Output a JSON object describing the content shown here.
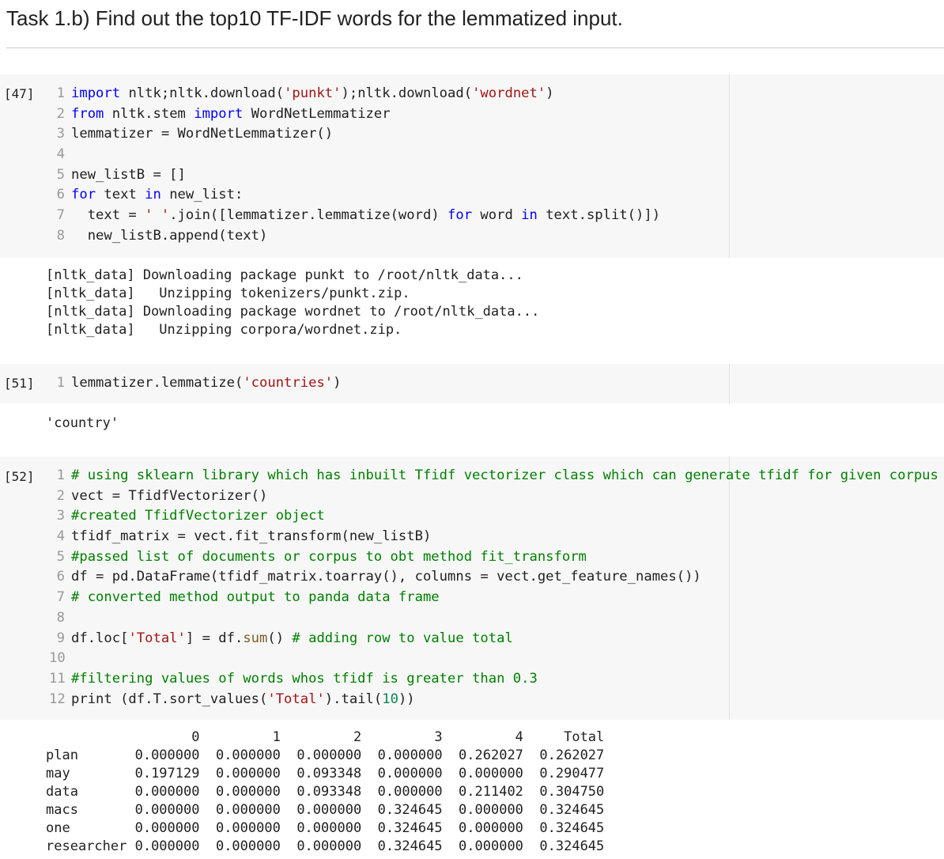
{
  "heading": "Task 1.b) Find out the top10 TF-IDF words for the lemmatized input.",
  "cells": {
    "c47": {
      "prompt": "[47]",
      "lines": [
        {
          "n": "1",
          "tokens": [
            {
              "t": "import",
              "c": "kw"
            },
            {
              "t": " nltk;nltk.download("
            },
            {
              "t": "'punkt'",
              "c": "str"
            },
            {
              "t": ");nltk.download("
            },
            {
              "t": "'wordnet'",
              "c": "str"
            },
            {
              "t": ")"
            }
          ]
        },
        {
          "n": "2",
          "tokens": [
            {
              "t": "from",
              "c": "kw"
            },
            {
              "t": " nltk.stem "
            },
            {
              "t": "import",
              "c": "kw"
            },
            {
              "t": " WordNetLemmatizer"
            }
          ]
        },
        {
          "n": "3",
          "tokens": [
            {
              "t": "lemmatizer = WordNetLemmatizer()"
            }
          ]
        },
        {
          "n": "4",
          "tokens": []
        },
        {
          "n": "5",
          "tokens": [
            {
              "t": "new_listB = []"
            }
          ]
        },
        {
          "n": "6",
          "tokens": [
            {
              "t": "for",
              "c": "kw"
            },
            {
              "t": " text "
            },
            {
              "t": "in",
              "c": "kw"
            },
            {
              "t": " new_list:"
            }
          ]
        },
        {
          "n": "7",
          "tokens": [
            {
              "t": "  text = "
            },
            {
              "t": "' '",
              "c": "str"
            },
            {
              "t": ".join([lemmatizer.lemmatize(word) "
            },
            {
              "t": "for",
              "c": "kw"
            },
            {
              "t": " word "
            },
            {
              "t": "in",
              "c": "kw"
            },
            {
              "t": " text.split()])"
            }
          ]
        },
        {
          "n": "8",
          "tokens": [
            {
              "t": "  new_listB.append(text)"
            }
          ]
        }
      ],
      "output": [
        "[nltk_data] Downloading package punkt to /root/nltk_data...",
        "[nltk_data]   Unzipping tokenizers/punkt.zip.",
        "[nltk_data] Downloading package wordnet to /root/nltk_data...",
        "[nltk_data]   Unzipping corpora/wordnet.zip."
      ]
    },
    "c51": {
      "prompt": "[51]",
      "lines": [
        {
          "n": "1",
          "tokens": [
            {
              "t": "lemmatizer.lemmatize("
            },
            {
              "t": "'countries'",
              "c": "str"
            },
            {
              "t": ")"
            }
          ]
        }
      ],
      "output": [
        "'country'"
      ]
    },
    "c52": {
      "prompt": "[52]",
      "lines": [
        {
          "n": "1",
          "tokens": [
            {
              "t": "# using sklearn library which has inbuilt Tfidf vectorizer class which can generate tfidf for given corpus",
              "c": "cm"
            }
          ]
        },
        {
          "n": "2",
          "tokens": [
            {
              "t": "vect = TfidfVectorizer()"
            }
          ]
        },
        {
          "n": "3",
          "tokens": [
            {
              "t": "#created TfidfVectorizer object",
              "c": "cm"
            }
          ]
        },
        {
          "n": "4",
          "tokens": [
            {
              "t": "tfidf_matrix = vect.fit_transform(new_listB)"
            }
          ]
        },
        {
          "n": "5",
          "tokens": [
            {
              "t": "#passed list of documents or corpus to obt method fit_transform",
              "c": "cm"
            }
          ]
        },
        {
          "n": "6",
          "tokens": [
            {
              "t": "df = pd.DataFrame(tfidf_matrix.toarray(), columns = vect.get_feature_names())"
            }
          ]
        },
        {
          "n": "7",
          "tokens": [
            {
              "t": "# converted method output to panda data frame",
              "c": "cm"
            }
          ]
        },
        {
          "n": "8",
          "tokens": []
        },
        {
          "n": "9",
          "tokens": [
            {
              "t": "df.loc["
            },
            {
              "t": "'Total'",
              "c": "str"
            },
            {
              "t": "] = df."
            },
            {
              "t": "sum",
              "c": "fn"
            },
            {
              "t": "() "
            },
            {
              "t": "# adding row to value total",
              "c": "cm"
            }
          ]
        },
        {
          "n": "10",
          "tokens": []
        },
        {
          "n": "11",
          "tokens": [
            {
              "t": "#filtering values of words whos tfidf is greater than 0.3",
              "c": "cm"
            }
          ]
        },
        {
          "n": "12",
          "tokens": [
            {
              "t": "print (df.T.sort_values("
            },
            {
              "t": "'Total'",
              "c": "str"
            },
            {
              "t": ").tail("
            },
            {
              "t": "10",
              "c": "num"
            },
            {
              "t": "))"
            }
          ]
        }
      ],
      "table": {
        "columns": [
          "0",
          "1",
          "2",
          "3",
          "4",
          "Total"
        ],
        "rows": [
          {
            "label": "plan",
            "values": [
              "0.000000",
              "0.000000",
              "0.000000",
              "0.000000",
              "0.262027",
              "0.262027"
            ]
          },
          {
            "label": "may",
            "values": [
              "0.197129",
              "0.000000",
              "0.093348",
              "0.000000",
              "0.000000",
              "0.290477"
            ]
          },
          {
            "label": "data",
            "values": [
              "0.000000",
              "0.000000",
              "0.093348",
              "0.000000",
              "0.211402",
              "0.304750"
            ]
          },
          {
            "label": "macs",
            "values": [
              "0.000000",
              "0.000000",
              "0.000000",
              "0.324645",
              "0.000000",
              "0.324645"
            ]
          },
          {
            "label": "one",
            "values": [
              "0.000000",
              "0.000000",
              "0.000000",
              "0.324645",
              "0.000000",
              "0.324645"
            ]
          },
          {
            "label": "researcher",
            "values": [
              "0.000000",
              "0.000000",
              "0.000000",
              "0.324645",
              "0.000000",
              "0.324645"
            ]
          }
        ]
      }
    }
  }
}
